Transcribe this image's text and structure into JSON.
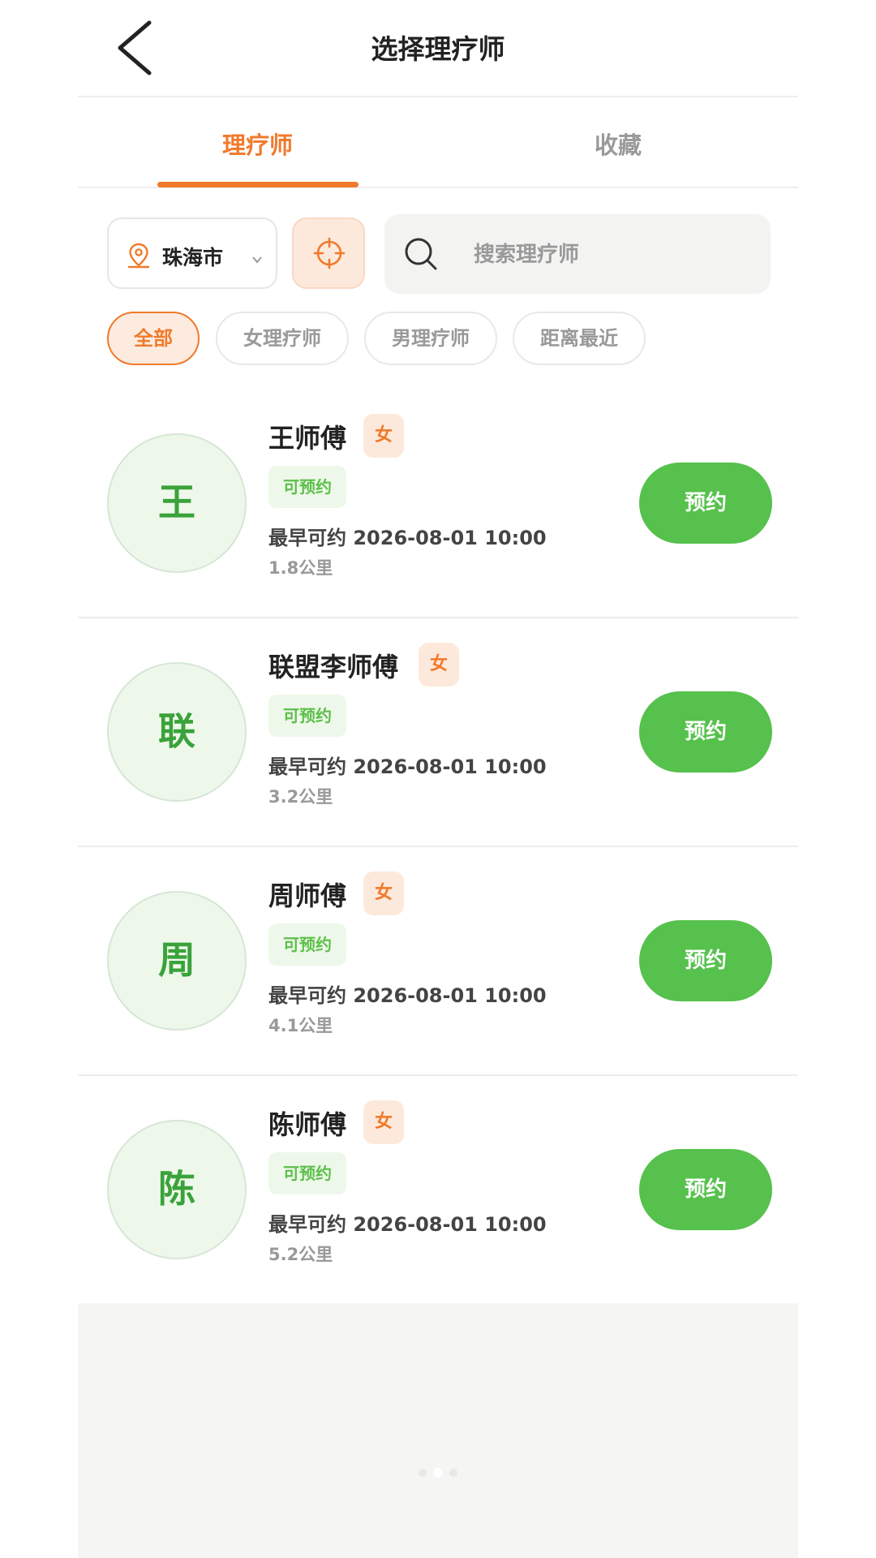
{
  "header": {
    "title": "选择理疗师"
  },
  "tabs": [
    {
      "label": "理疗师",
      "active": true
    },
    {
      "label": "收藏",
      "active": false
    }
  ],
  "filter": {
    "city": "珠海市",
    "search_placeholder": "搜索理疗师"
  },
  "chips": [
    {
      "label": "全部",
      "active": true
    },
    {
      "label": "女理疗师",
      "active": false
    },
    {
      "label": "男理疗师",
      "active": false
    },
    {
      "label": "距离最近",
      "active": false
    }
  ],
  "therapists": [
    {
      "avatar": "王",
      "name": "王师傅",
      "gender": "女",
      "status": "可预约",
      "time": "最早可约 2026-08-01 10:00",
      "distance": "1.8公里",
      "button": "预约"
    },
    {
      "avatar": "联",
      "name": "联盟李师傅",
      "gender": "女",
      "status": "可预约",
      "time": "最早可约 2026-08-01 10:00",
      "distance": "3.2公里",
      "button": "预约"
    },
    {
      "avatar": "周",
      "name": "周师傅",
      "gender": "女",
      "status": "可预约",
      "time": "最早可约 2026-08-01 10:00",
      "distance": "4.1公里",
      "button": "预约"
    },
    {
      "avatar": "陈",
      "name": "陈师傅",
      "gender": "女",
      "status": "可预约",
      "time": "最早可约 2026-08-01 10:00",
      "distance": "5.2公里",
      "button": "预约"
    }
  ],
  "colors": {
    "accent": "#f07a2c",
    "green": "#56c14c"
  }
}
